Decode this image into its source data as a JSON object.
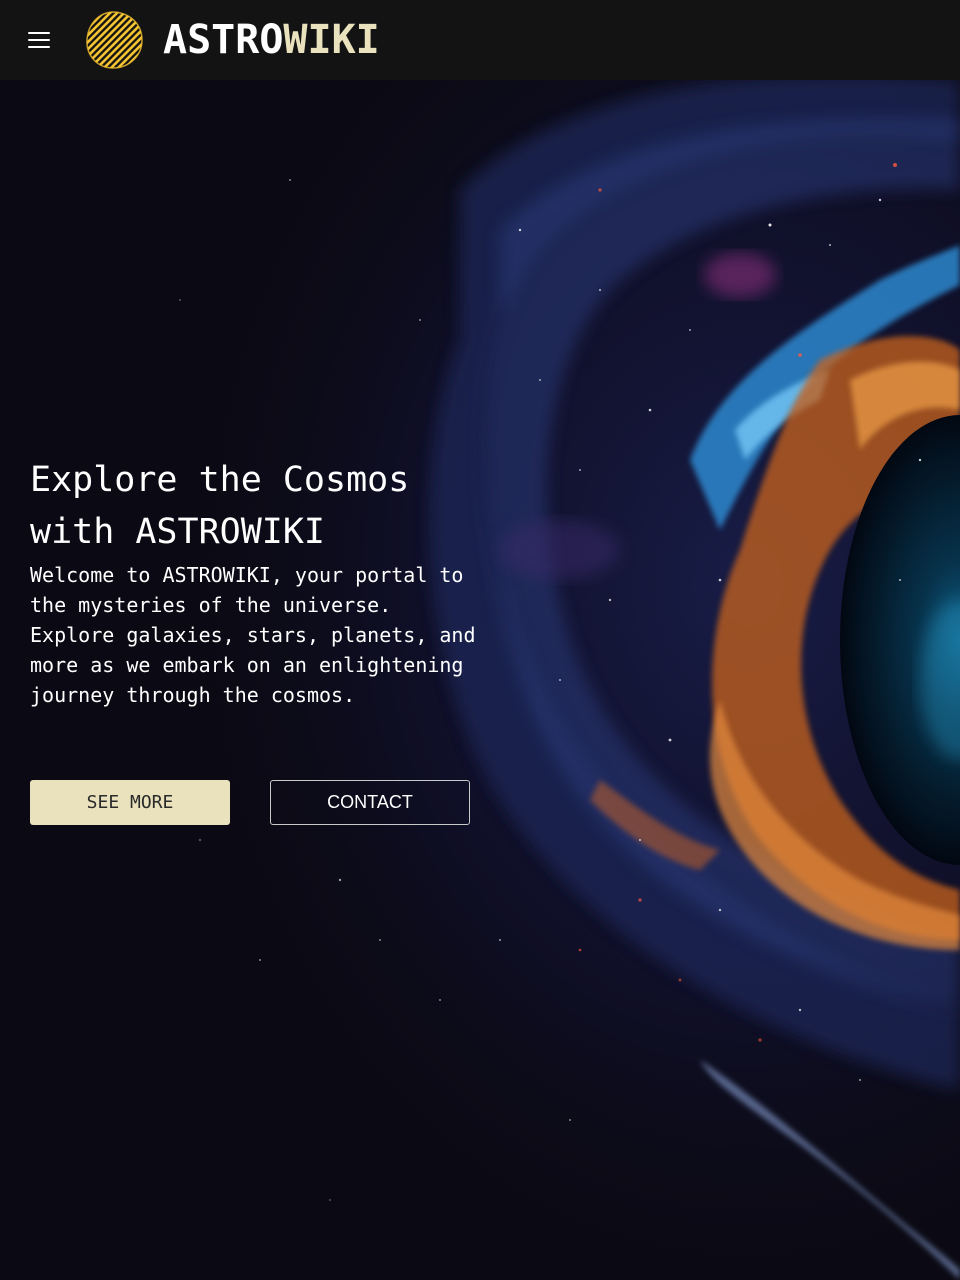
{
  "header": {
    "menu_icon": "hamburger-menu-icon",
    "logo_icon": "hatched-yellow-sun-logo",
    "brand_part1": "ASTRO",
    "brand_part2": "WIKI"
  },
  "hero": {
    "title": "Explore the Cosmos with ASTROWIKI",
    "description": "Welcome to ASTROWIKI, your portal to the mysteries of the universe. Explore galaxies, stars, planets, and more as we embark on an enlightening journey through the cosmos.",
    "primary_button": "SEE MORE",
    "secondary_button": "CONTACT"
  },
  "colors": {
    "navbar_bg": "#131313",
    "accent": "#e9e2bc",
    "logo_yellow": "#f2c230",
    "background": "#0b0a14"
  }
}
